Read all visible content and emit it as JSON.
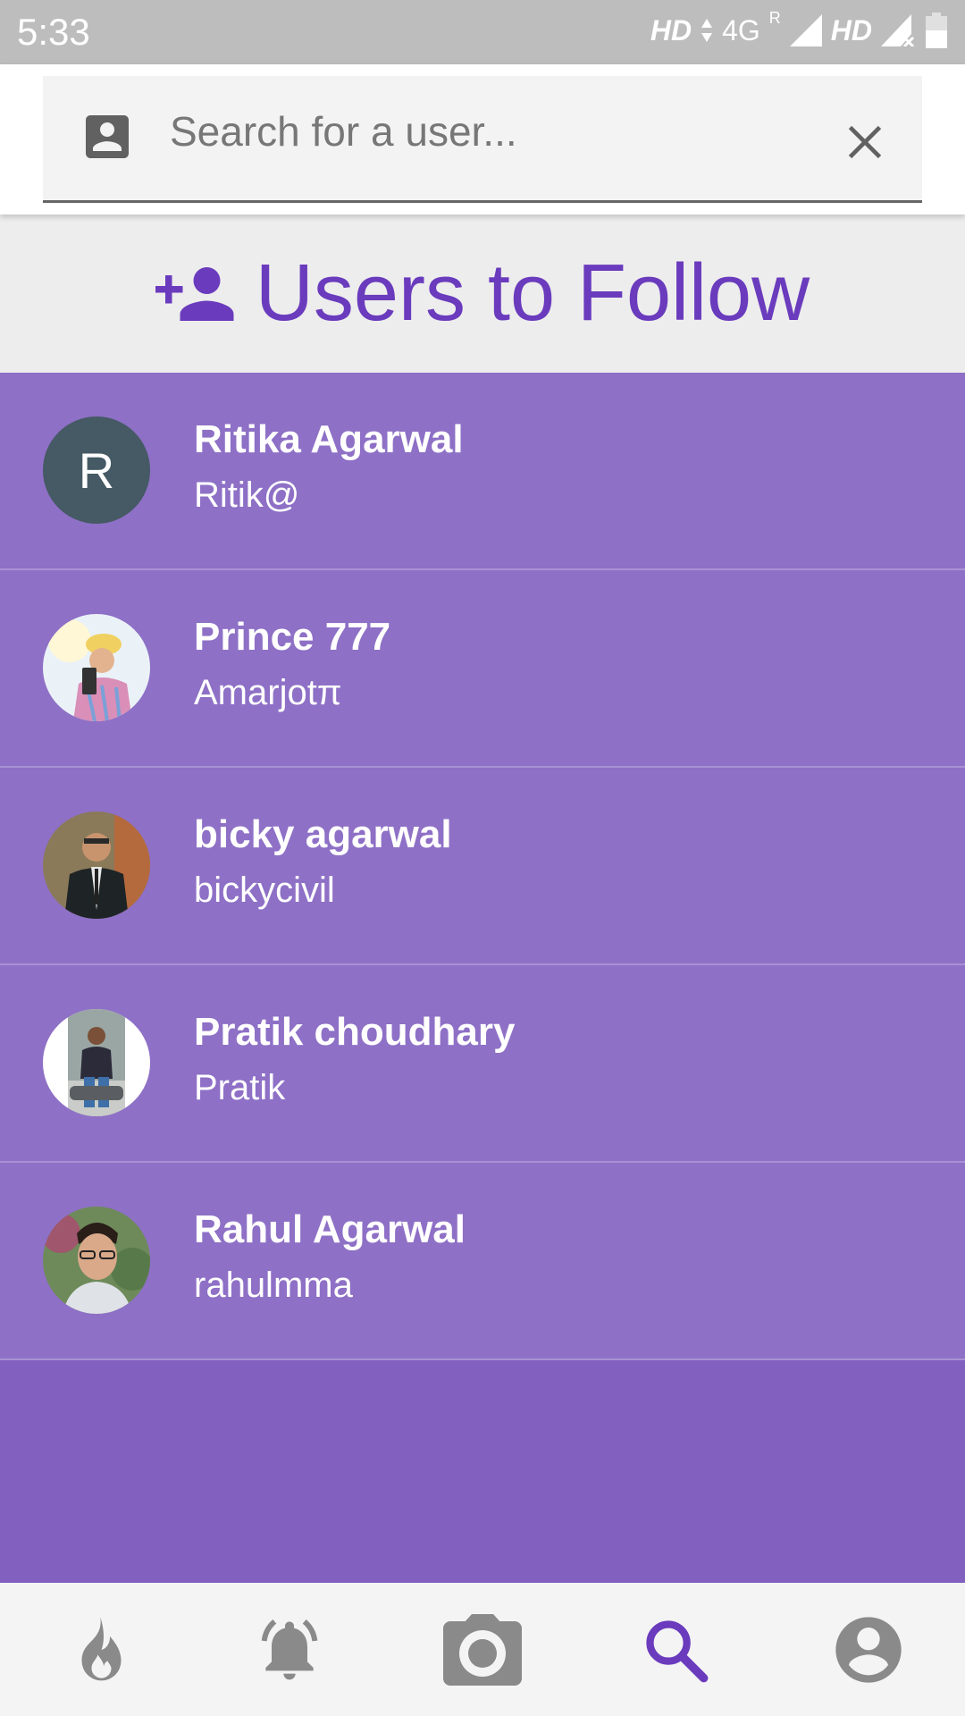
{
  "status_bar": {
    "time": "5:33",
    "hd_label": "HD",
    "network_label": "4G",
    "roaming_label": "R"
  },
  "search": {
    "placeholder": "Search for a user...",
    "value": "",
    "icon": "account-box-icon",
    "clear_icon": "close-icon"
  },
  "section": {
    "title": "Users to Follow",
    "icon": "person-add-icon"
  },
  "users": [
    {
      "name": "Ritika Agarwal",
      "handle": "Ritik@",
      "avatar_letter": "R",
      "avatar_color": "#455a64"
    },
    {
      "name": "Prince 777",
      "handle": "Amarjotπ"
    },
    {
      "name": "bicky agarwal",
      "handle": "bickycivil"
    },
    {
      "name": "Pratik choudhary",
      "handle": "Pratik"
    },
    {
      "name": "Rahul Agarwal",
      "handle": "rahulmma"
    }
  ],
  "nav": {
    "items": [
      "flame-icon",
      "bell-icon",
      "camera-icon",
      "search-icon",
      "account-circle-icon"
    ],
    "active": "search-icon"
  },
  "colors": {
    "accent": "#6a3bbd",
    "list_background": "#8e70c6",
    "page_background": "#8260c0",
    "nav_icon": "#8a8a8a"
  }
}
